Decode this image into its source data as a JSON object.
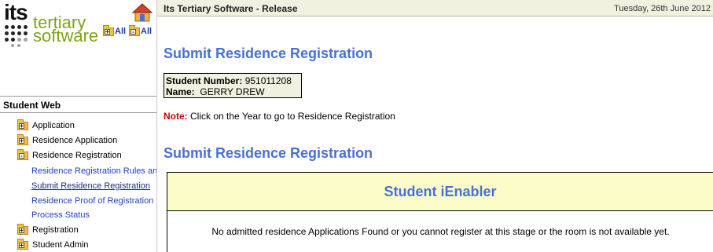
{
  "logo": {
    "line1": "its",
    "line2": "tertiary",
    "line3": "software"
  },
  "left": {
    "expand_all": "All",
    "collapse_all": "All",
    "section_title": "Student Web",
    "items": [
      {
        "label": "Application",
        "sign": "+"
      },
      {
        "label": "Residence Application",
        "sign": "+"
      },
      {
        "label": "Residence Registration",
        "sign": "-"
      }
    ],
    "subitems": [
      "Residence Registration Rules and",
      "Submit Residence Registration",
      "Residence Proof of Registration",
      "Process Status"
    ],
    "items_after": [
      {
        "label": "Registration",
        "sign": "+"
      },
      {
        "label": "Student Admin",
        "sign": "+"
      }
    ]
  },
  "header": {
    "title": "Its Tertiary Software - Release",
    "date": "Tuesday, 26th June 2012"
  },
  "main": {
    "heading1": "Submit Residence Registration",
    "student_number_label": "Student Number:",
    "student_number": "951011208",
    "name_label": "Name:",
    "name": "GERRY DREW",
    "note_label": "Note:",
    "note_text": "Click on the Year to go to Residence Registration",
    "heading2": "Submit Residence Registration",
    "panel_title": "Student iEnabler",
    "panel_message": "No admitted residence Applications Found or you cannot register at this stage or the room is not available yet."
  },
  "colors": {
    "heading": "#4a6fd6",
    "header_bg": "#f1f1e0",
    "panel_bg": "#fcfcc8",
    "note": "#cc0000",
    "logo_green": "#7fa31a"
  }
}
